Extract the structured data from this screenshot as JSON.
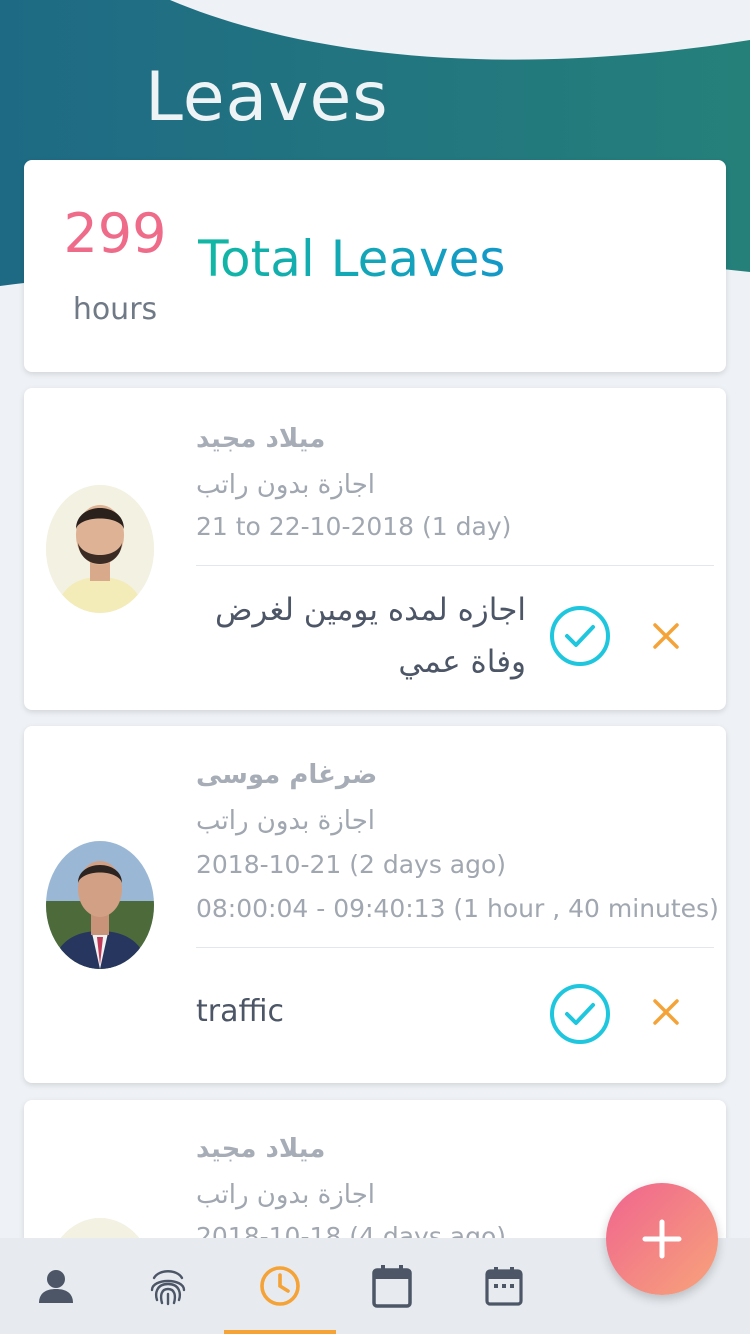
{
  "colors": {
    "header_teal": "#1f6f86",
    "accent_pink": "#ef6b8a",
    "approve_cyan": "#1ec6de",
    "reject_orange": "#f5a236",
    "active_tab": "#f5a236",
    "inactive_tab": "#4c5666"
  },
  "header": {
    "title": "Leaves"
  },
  "summary": {
    "value": "299",
    "unit": "hours",
    "label": "Total Leaves"
  },
  "leaves": [
    {
      "name": "ميلاد مجيد",
      "type": "اجازة بدون راتب",
      "date": "21 to 22-10-2018 (1 day)",
      "reason_line1": "اجازه لمده يومين لغرض",
      "reason_line2": "وفاة عمي"
    },
    {
      "name": "ضرغام موسى",
      "type": "اجازة بدون راتب",
      "date": "2018-10-21 (2 days ago)",
      "time": "08:00:04 - 09:40:13 (1 hour ,  40 minutes)",
      "reason_line1": "traffic"
    },
    {
      "name": "ميلاد مجيد",
      "type": "اجازة بدون راتب",
      "date": "2018-10-18 (4 days ago)"
    }
  ],
  "tabs": [
    {
      "icon": "person-icon",
      "active": false
    },
    {
      "icon": "fingerprint-icon",
      "active": false
    },
    {
      "icon": "clock-icon",
      "active": true
    },
    {
      "icon": "calendar-icon",
      "active": false
    },
    {
      "icon": "calendar-grid-icon",
      "active": false
    }
  ],
  "fab": {
    "icon": "plus-icon"
  }
}
